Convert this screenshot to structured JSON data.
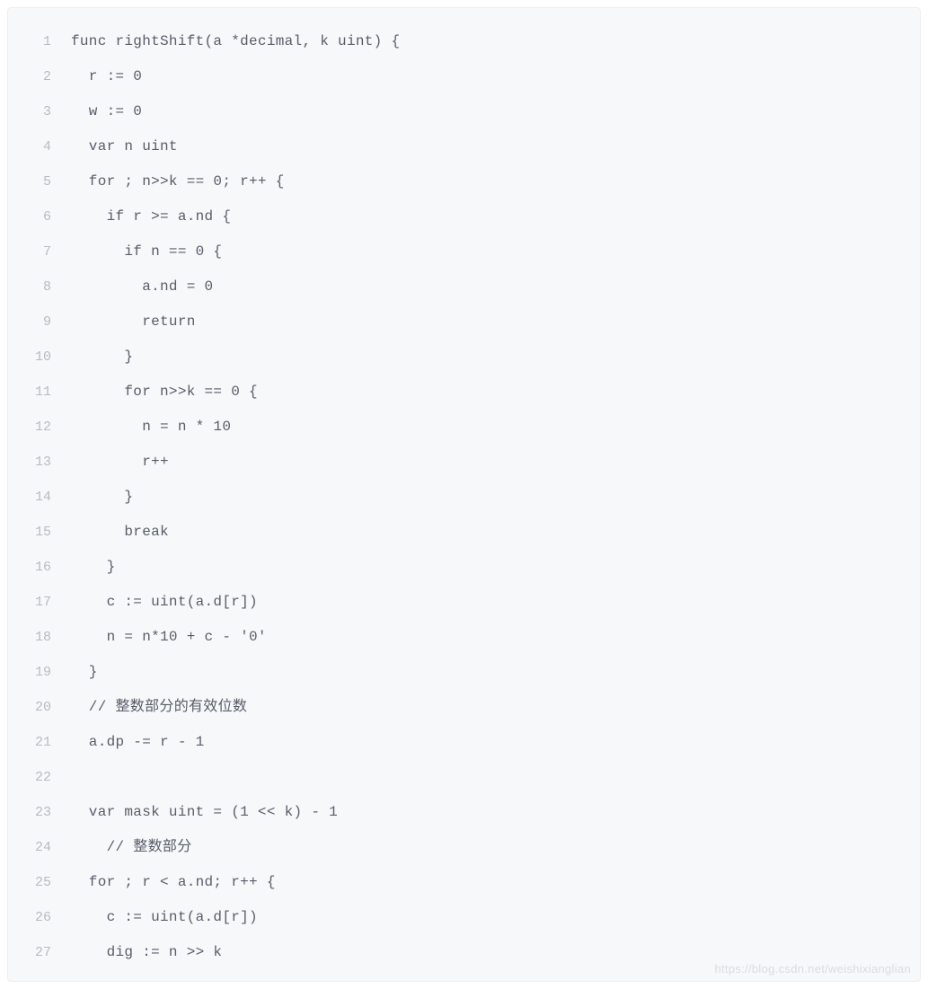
{
  "watermark": "https://blog.csdn.net/weishixianglian",
  "lines": [
    {
      "n": "1",
      "t": "func rightShift(a *decimal, k uint) {"
    },
    {
      "n": "2",
      "t": "  r := 0"
    },
    {
      "n": "3",
      "t": "  w := 0"
    },
    {
      "n": "4",
      "t": "  var n uint"
    },
    {
      "n": "5",
      "t": "  for ; n>>k == 0; r++ {"
    },
    {
      "n": "6",
      "t": "    if r >= a.nd {"
    },
    {
      "n": "7",
      "t": "      if n == 0 {"
    },
    {
      "n": "8",
      "t": "        a.nd = 0"
    },
    {
      "n": "9",
      "t": "        return"
    },
    {
      "n": "10",
      "t": "      }"
    },
    {
      "n": "11",
      "t": "      for n>>k == 0 {"
    },
    {
      "n": "12",
      "t": "        n = n * 10"
    },
    {
      "n": "13",
      "t": "        r++"
    },
    {
      "n": "14",
      "t": "      }"
    },
    {
      "n": "15",
      "t": "      break"
    },
    {
      "n": "16",
      "t": "    }"
    },
    {
      "n": "17",
      "t": "    c := uint(a.d[r])"
    },
    {
      "n": "18",
      "t": "    n = n*10 + c - '0'"
    },
    {
      "n": "19",
      "t": "  }"
    },
    {
      "n": "20",
      "t": "  // 整数部分的有效位数"
    },
    {
      "n": "21",
      "t": "  a.dp -= r - 1"
    },
    {
      "n": "22",
      "t": ""
    },
    {
      "n": "23",
      "t": "  var mask uint = (1 << k) - 1"
    },
    {
      "n": "24",
      "t": "    // 整数部分"
    },
    {
      "n": "25",
      "t": "  for ; r < a.nd; r++ {"
    },
    {
      "n": "26",
      "t": "    c := uint(a.d[r])"
    },
    {
      "n": "27",
      "t": "    dig := n >> k"
    }
  ]
}
